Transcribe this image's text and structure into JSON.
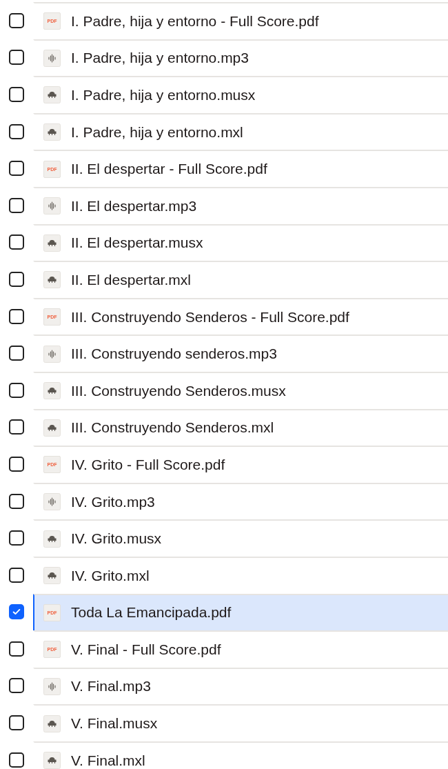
{
  "files": [
    {
      "name": "I. Padre, hija y entorno - Full Score.pdf",
      "kind": "pdf",
      "icon_text": "PDF",
      "selected": false
    },
    {
      "name": "I. Padre, hija y entorno.mp3",
      "kind": "audio",
      "selected": false
    },
    {
      "name": "I. Padre, hija y entorno.musx",
      "kind": "score",
      "selected": false
    },
    {
      "name": "I. Padre, hija y entorno.mxl",
      "kind": "score",
      "selected": false
    },
    {
      "name": "II. El despertar - Full Score.pdf",
      "kind": "pdf",
      "icon_text": "PDF",
      "selected": false
    },
    {
      "name": "II. El despertar.mp3",
      "kind": "audio",
      "selected": false
    },
    {
      "name": "II. El despertar.musx",
      "kind": "score",
      "selected": false
    },
    {
      "name": "II. El despertar.mxl",
      "kind": "score",
      "selected": false
    },
    {
      "name": "III. Construyendo Senderos - Full Score.pdf",
      "kind": "pdf",
      "icon_text": "PDF",
      "selected": false
    },
    {
      "name": "III. Construyendo senderos.mp3",
      "kind": "audio",
      "selected": false
    },
    {
      "name": "III. Construyendo Senderos.musx",
      "kind": "score",
      "selected": false
    },
    {
      "name": "III. Construyendo Senderos.mxl",
      "kind": "score",
      "selected": false
    },
    {
      "name": "IV. Grito - Full Score.pdf",
      "kind": "pdf",
      "icon_text": "PDF",
      "selected": false
    },
    {
      "name": "IV. Grito.mp3",
      "kind": "audio",
      "selected": false
    },
    {
      "name": "IV. Grito.musx",
      "kind": "score",
      "selected": false
    },
    {
      "name": "IV. Grito.mxl",
      "kind": "score",
      "selected": false
    },
    {
      "name": "Toda La Emancipada.pdf",
      "kind": "pdf",
      "icon_text": "PDF",
      "selected": true
    },
    {
      "name": "V. Final - Full Score.pdf",
      "kind": "pdf",
      "icon_text": "PDF",
      "selected": false
    },
    {
      "name": "V. Final.mp3",
      "kind": "audio",
      "selected": false
    },
    {
      "name": "V. Final.musx",
      "kind": "score",
      "selected": false
    },
    {
      "name": "V. Final.mxl",
      "kind": "score",
      "selected": false
    }
  ]
}
